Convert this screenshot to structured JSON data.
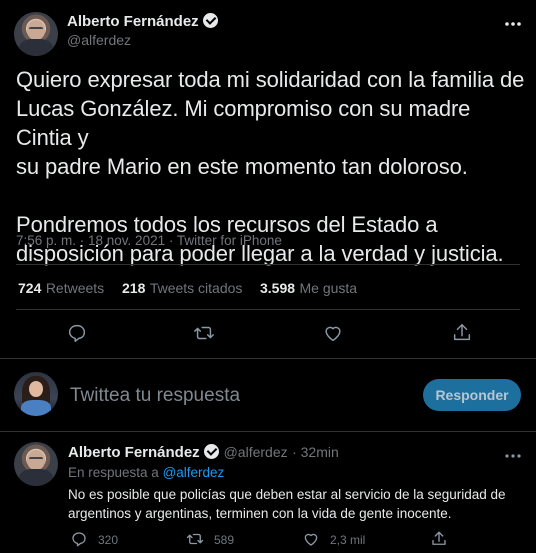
{
  "tweet": {
    "author_name": "Alberto Fernández",
    "author_handle": "@alferdez",
    "text": "Quiero expresar toda mi solidaridad con la familia de\nLucas González. Mi compromiso con su madre Cintia y\nsu padre Mario en este momento tan doloroso.\n\nPondremos todos los recursos del Estado a\ndisposición para poder llegar a la verdad y justicia.",
    "meta": "7:56 p. m. · 18 nov. 2021 · Twitter for iPhone",
    "stats": {
      "retweets_num": "724",
      "retweets_label": "Retweets",
      "quotes_num": "218",
      "quotes_label": "Tweets citados",
      "likes_num": "3.598",
      "likes_label": "Me gusta"
    }
  },
  "compose": {
    "placeholder": "Twittea tu respuesta",
    "reply_button": "Responder"
  },
  "reply": {
    "author_name": "Alberto Fernández",
    "author_handle": "@alferdez",
    "time": "· 32min",
    "in_reply_prefix": "En respuesta a",
    "in_reply_handle": "@alferdez",
    "text": "No es posible que policías que deben estar al servicio de la seguridad de\nargentinos y argentinas, terminen con la vida de gente inocente.",
    "counts": {
      "replies": "320",
      "retweets": "589",
      "likes": "2,3 mil"
    }
  },
  "colors": {
    "background": "#000000",
    "text": "#e7e9ea",
    "muted": "#71767b",
    "link": "#1d9bf0",
    "button": "#1d6f9e"
  },
  "icons": [
    "verified-badge-icon",
    "more-icon",
    "reply-icon",
    "retweet-icon",
    "like-icon",
    "share-icon"
  ]
}
